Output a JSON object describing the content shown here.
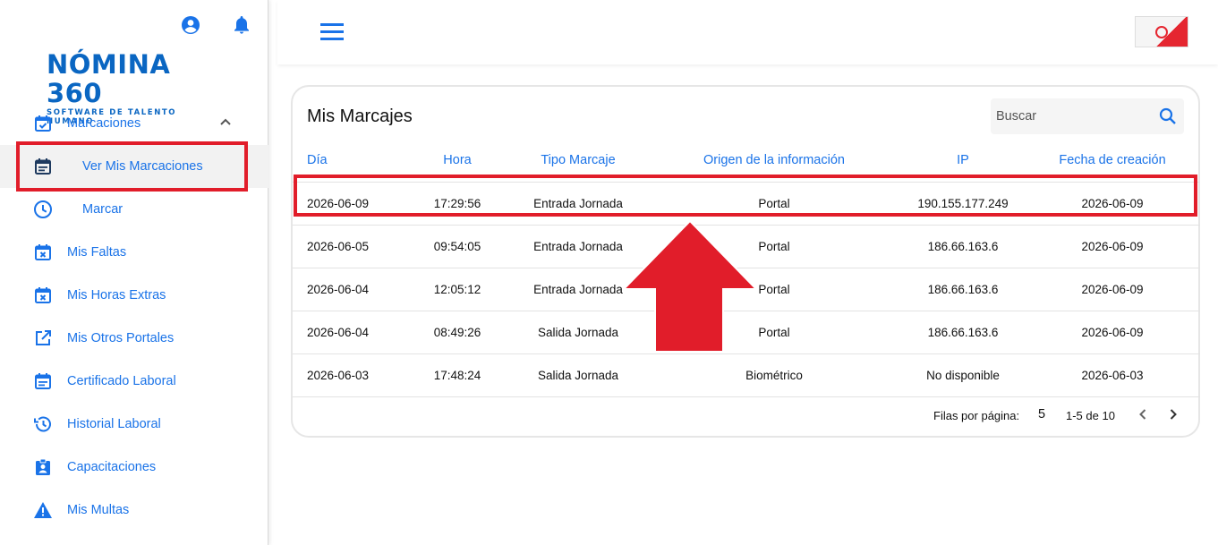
{
  "brand": {
    "name": "NÓMINA 360",
    "tagline": "SOFTWARE DE TALENTO HUMANO"
  },
  "sidebar": {
    "items": [
      {
        "label": "Marcaciones",
        "icon": "calendar-check-icon"
      },
      {
        "label": "Ver Mis Marcaciones",
        "icon": "calendar-list-icon"
      },
      {
        "label": "Marcar",
        "icon": "clock-icon"
      },
      {
        "label": "Mis Faltas",
        "icon": "calendar-x-icon"
      },
      {
        "label": "Mis Horas Extras",
        "icon": "calendar-x-icon"
      },
      {
        "label": "Mis Otros Portales",
        "icon": "open-in-new-icon"
      },
      {
        "label": "Certificado Laboral",
        "icon": "calendar-list-icon"
      },
      {
        "label": "Historial Laboral",
        "icon": "history-icon"
      },
      {
        "label": "Capacitaciones",
        "icon": "assignment-ind-icon"
      },
      {
        "label": "Mis Multas",
        "icon": "warning-icon"
      }
    ]
  },
  "card": {
    "title": "Mis Marcajes",
    "search_placeholder": "Buscar"
  },
  "table": {
    "headers": {
      "dia": "Día",
      "hora": "Hora",
      "tipo": "Tipo Marcaje",
      "origen": "Origen de la información",
      "ip": "IP",
      "fecha": "Fecha de creación"
    },
    "rows": [
      {
        "dia": "2026-06-09",
        "hora": "17:29:56",
        "tipo": "Entrada Jornada",
        "origen": "Portal",
        "ip": "190.155.177.249",
        "fecha": "2026-06-09"
      },
      {
        "dia": "2026-06-05",
        "hora": "09:54:05",
        "tipo": "Entrada Jornada",
        "origen": "Portal",
        "ip": "186.66.163.6",
        "fecha": "2026-06-09"
      },
      {
        "dia": "2026-06-04",
        "hora": "12:05:12",
        "tipo": "Entrada Jornada",
        "origen": "Portal",
        "ip": "186.66.163.6",
        "fecha": "2026-06-09"
      },
      {
        "dia": "2026-06-04",
        "hora": "08:49:26",
        "tipo": "Salida Jornada",
        "origen": "Portal",
        "ip": "186.66.163.6",
        "fecha": "2026-06-09"
      },
      {
        "dia": "2026-06-03",
        "hora": "17:48:24",
        "tipo": "Salida Jornada",
        "origen": "Biométrico",
        "ip": "No disponible",
        "fecha": "2026-06-03"
      }
    ]
  },
  "pager": {
    "label": "Filas por página:",
    "rows_per_page": "5",
    "range": "1-5 de 10"
  },
  "colors": {
    "accent": "#1a73e8",
    "brand": "#0a66c2",
    "annotation": "#e11d2a"
  }
}
